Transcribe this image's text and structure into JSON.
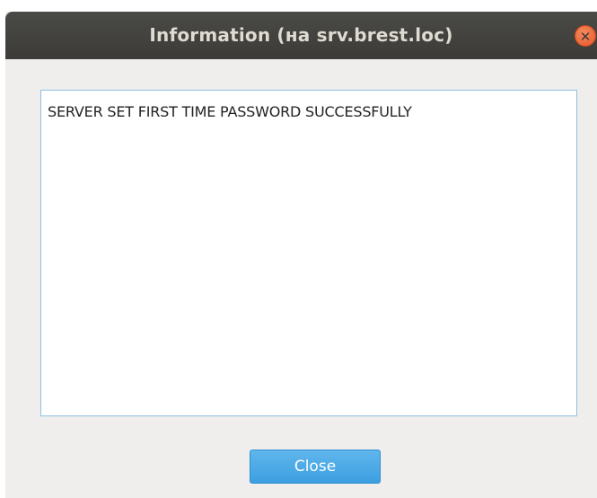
{
  "window": {
    "title": "Information (на srv.brest.loc)",
    "close_icon": "close-icon"
  },
  "message": {
    "text": "SERVER SET FIRST TIME PASSWORD SUCCESSFULLY"
  },
  "buttons": {
    "close_label": "Close"
  }
}
